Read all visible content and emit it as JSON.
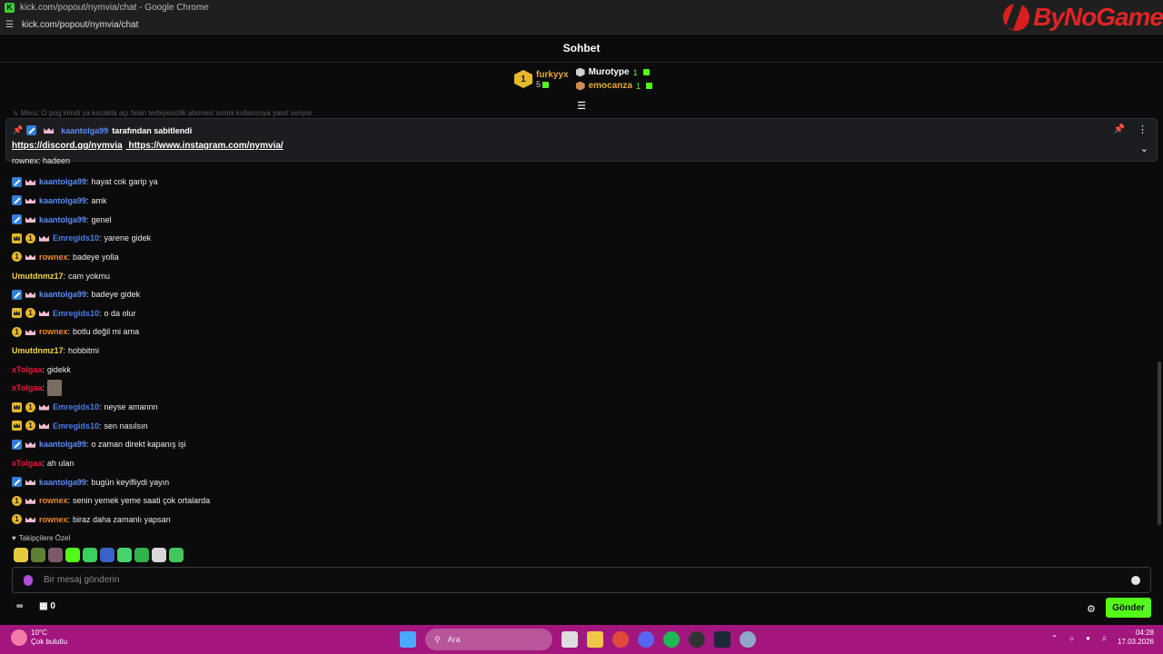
{
  "browser": {
    "window_title": "kick.com/popout/nymvia/chat - Google Chrome",
    "favicon": "K",
    "url": "kick.com/popout/nymvia/chat",
    "brand_name": "ByNoGame"
  },
  "chat": {
    "title": "Sohbet",
    "faded_line": "↳ Meru: O pog kimdi ya kocakta açı falan terbiyesizlik abonesi ismini kullanıcıya yanıt veriyor",
    "leaderboard": {
      "first": {
        "rank": "1",
        "name": "furkyyx",
        "count": "5"
      },
      "second": {
        "name": "Murotype",
        "count": "1"
      },
      "third": {
        "name": "emocanza",
        "count": "1"
      }
    },
    "pinned": {
      "author": "kaantolga99",
      "suffix": "tarafından sabitlendi",
      "link1": "https://discord.gg/nymvia",
      "link2": "https://www.instagram.com/nymvia/"
    },
    "cut_top_text": "rownex: hadeen",
    "messages": [
      {
        "user": "kaantolga99",
        "text": "hayat cok garip ya"
      },
      {
        "user": "kaantolga99",
        "text": "amk"
      },
      {
        "user": "kaantolga99",
        "text": "genel"
      },
      {
        "user": "Emregids10",
        "text": "yarene gidek"
      },
      {
        "user": "rownex",
        "text": "badeye yolla"
      },
      {
        "user": "Umutdnmz17",
        "text": "cam yokmu"
      },
      {
        "user": "kaantolga99",
        "text": "badeye gidek"
      },
      {
        "user": "Emregids10",
        "text": "o da olur"
      },
      {
        "user": "rownex",
        "text": "botlu değil mi ama"
      },
      {
        "user": "Umutdnmz17",
        "text": "hobbitmi"
      },
      {
        "user": "xTolgaa",
        "text": "gidekk"
      },
      {
        "user": "xTolgaa",
        "text": ""
      },
      {
        "user": "Emregids10",
        "text": "neyse amannn"
      },
      {
        "user": "Emregids10",
        "text": "sen nasılsın"
      },
      {
        "user": "kaantolga99",
        "text": "o zaman direkt kapanış işi"
      },
      {
        "user": "xTolgaa",
        "text": "ah ulan"
      },
      {
        "user": "kaantolga99",
        "text": "bugün keyifliydi yayın"
      },
      {
        "user": "rownex",
        "text": "senin yemek yeme saati çok ortalarda"
      },
      {
        "user": "rownex",
        "text": "biraz daha zamanlı yapsan"
      }
    ],
    "followers_label": "Takipçilere Özel",
    "input_placeholder": "Bir mesaj gönderin",
    "points_count": "0",
    "send_label": "Gönder"
  },
  "taskbar": {
    "temperature": "10°C",
    "condition": "Çok bulutlu",
    "search_label": "Ara",
    "time": "04:28",
    "date": "17.03.2026"
  },
  "colors": {
    "accent": "#53fc18",
    "taskbar": "#a3167d"
  }
}
